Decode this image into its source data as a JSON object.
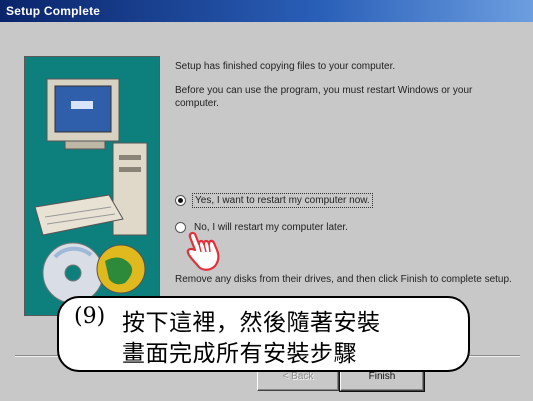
{
  "window": {
    "title": "Setup Complete"
  },
  "messages": {
    "copied": "Setup has finished copying files to your computer.",
    "restart_prompt": "Before you can use the program, you must restart Windows or your computer.",
    "remove_disks": "Remove any disks from their drives, and then click Finish to complete setup."
  },
  "options": [
    {
      "label": "Yes, I want to restart my computer now.",
      "selected": true
    },
    {
      "label": "No, I will restart my computer later.",
      "selected": false
    }
  ],
  "buttons": {
    "back": "< Back",
    "finish": "Finish"
  },
  "callout": {
    "number": "(9)",
    "line1": "按下這裡，然後隨著安裝",
    "line2": "畫面完成所有安裝步驟"
  },
  "colors": {
    "title_bar": "#0a246a",
    "art_panel": "#0d7f7d",
    "dialog": "#c8c8c8"
  }
}
